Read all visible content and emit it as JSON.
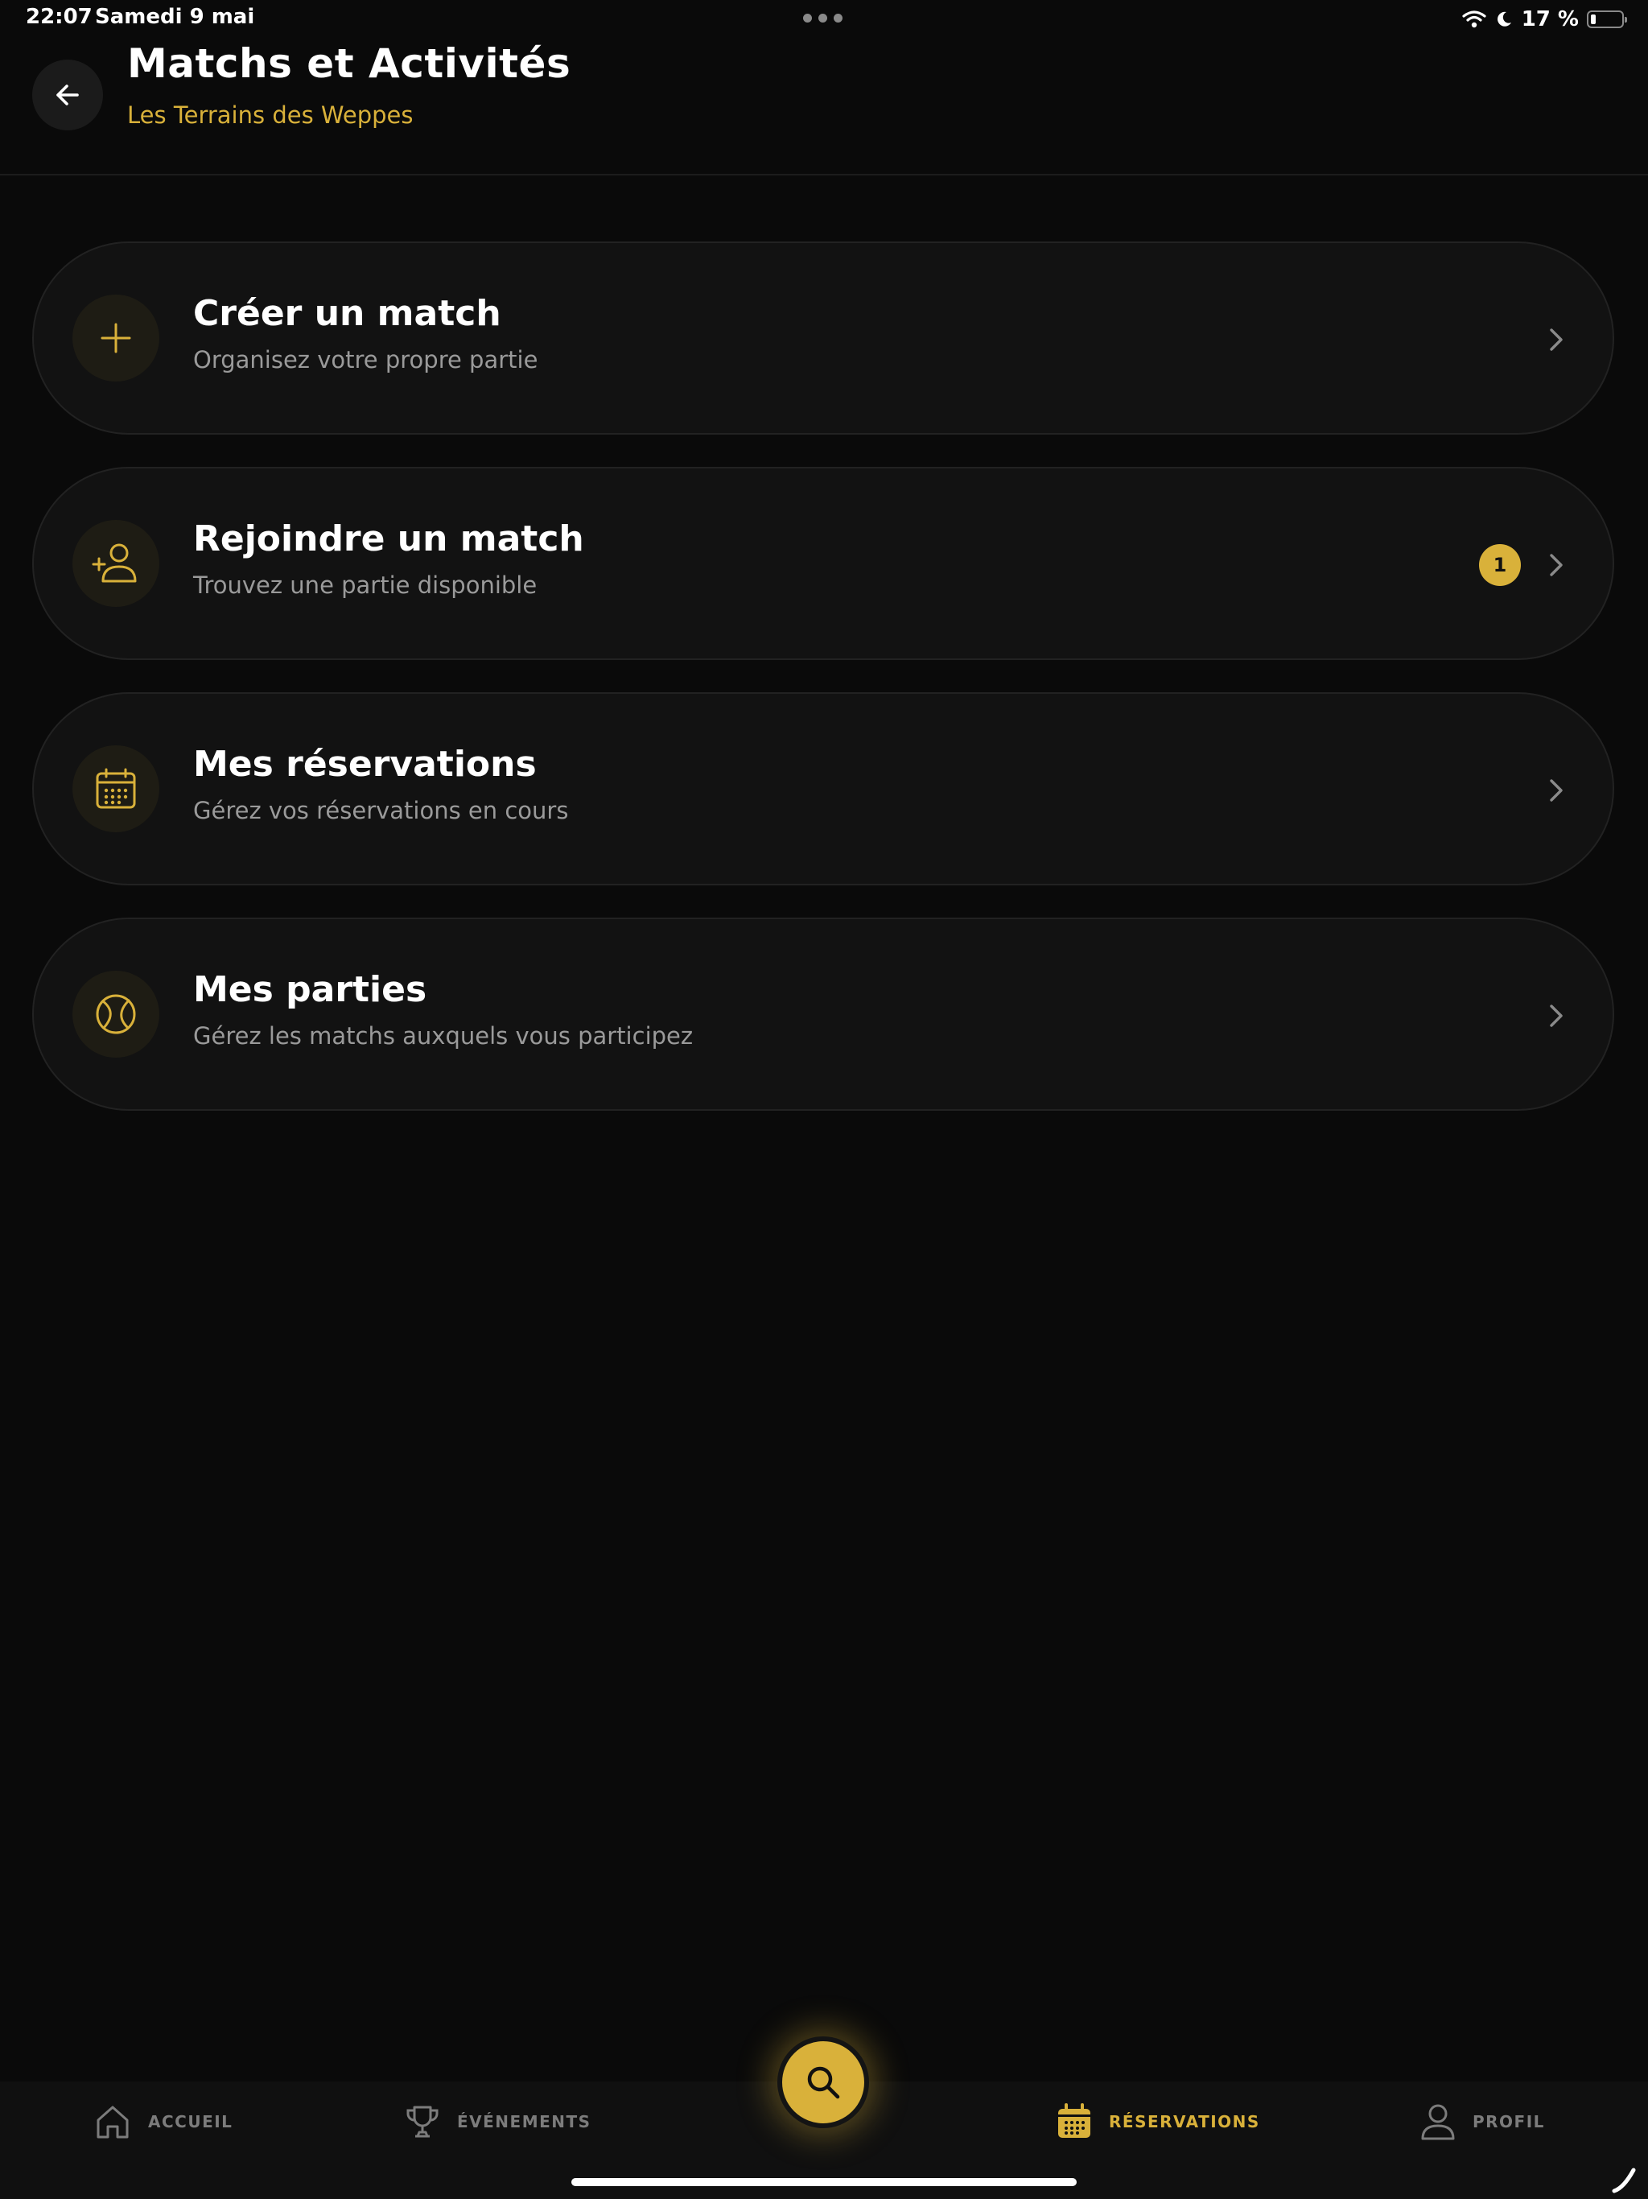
{
  "status_bar": {
    "time": "22:07",
    "date": "Samedi 9 mai",
    "battery_percent": "17 %",
    "battery_level": 0.17,
    "icons": [
      "wifi-icon",
      "moon-icon",
      "battery-icon"
    ]
  },
  "header": {
    "title": "Matchs et Activités",
    "subtitle": "Les Terrains des Weppes",
    "back_icon": "arrow-left-icon"
  },
  "cards": [
    {
      "title": "Créer un match",
      "description": "Organisez votre propre partie",
      "icon": "plus-icon",
      "badge": ""
    },
    {
      "title": "Rejoindre un match",
      "description": "Trouvez une partie disponible",
      "icon": "user-plus-icon",
      "badge": "1"
    },
    {
      "title": "Mes réservations",
      "description": "Gérez vos réservations en cours",
      "icon": "calendar-icon",
      "badge": ""
    },
    {
      "title": "Mes parties",
      "description": "Gérez les matchs auxquels vous participez",
      "icon": "tennis-ball-icon",
      "badge": ""
    }
  ],
  "bottom_nav": {
    "items": [
      {
        "label": "ACCUEIL",
        "icon": "home-icon",
        "active": false
      },
      {
        "label": "ÉVÉNEMENTS",
        "icon": "trophy-icon",
        "active": false
      },
      {
        "label": "RÉSERVATIONS",
        "icon": "calendar-icon",
        "active": true
      },
      {
        "label": "PROFIL",
        "icon": "user-icon",
        "active": false
      }
    ],
    "search_icon": "search-icon"
  },
  "colors": {
    "accent": "#d9b13a",
    "background": "#0a0a0a",
    "card": "#121212",
    "muted_text": "#9a9a9a"
  }
}
